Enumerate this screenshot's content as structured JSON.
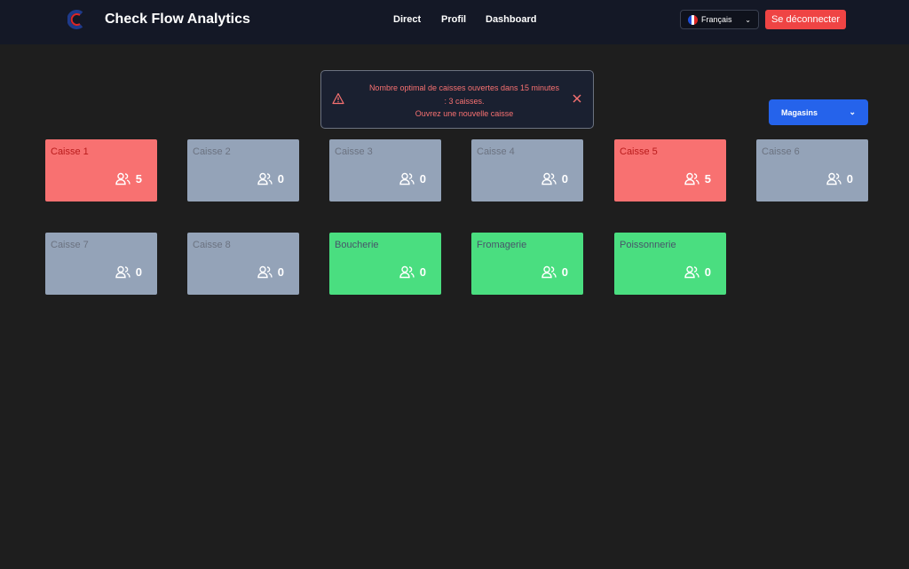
{
  "navbar": {
    "brand": "Check Flow Analytics",
    "links": [
      "Direct",
      "Profil",
      "Dashboard"
    ],
    "language": "Français",
    "logout_label": "Se déconnecter",
    "logo_icon": "c-logo-icon"
  },
  "alert": {
    "line1": "Nombre optimal de caisses ouvertes dans 15 minutes",
    "line2": ": 3 caisses.",
    "line3": "Ouvrez une nouvelle caisse",
    "color": "#f87171"
  },
  "store_selector": {
    "label": "Magasins"
  },
  "colors": {
    "busy": "#f87171",
    "closed": "#94a3b8",
    "open": "#4ade80",
    "accent": "#2563eb",
    "danger": "#ef4444"
  },
  "registers": [
    {
      "name": "Caisse 1",
      "count": "5",
      "status": "busy"
    },
    {
      "name": "Caisse 2",
      "count": "0",
      "status": "closed"
    },
    {
      "name": "Caisse 3",
      "count": "0",
      "status": "closed"
    },
    {
      "name": "Caisse 4",
      "count": "0",
      "status": "closed"
    },
    {
      "name": "Caisse 5",
      "count": "5",
      "status": "busy"
    },
    {
      "name": "Caisse 6",
      "count": "0",
      "status": "closed"
    },
    {
      "name": "Caisse 7",
      "count": "0",
      "status": "closed"
    },
    {
      "name": "Caisse 8",
      "count": "0",
      "status": "closed"
    },
    {
      "name": "Boucherie",
      "count": "0",
      "status": "open"
    },
    {
      "name": "Fromagerie",
      "count": "0",
      "status": "open"
    },
    {
      "name": "Poissonnerie",
      "count": "0",
      "status": "open"
    }
  ]
}
